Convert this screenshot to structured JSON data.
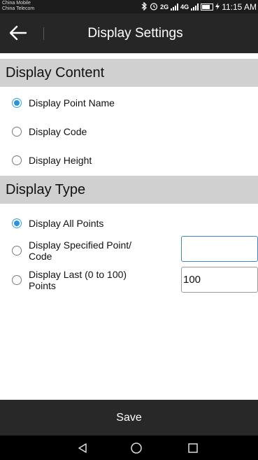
{
  "status_bar": {
    "carrier_1": "China Mobile",
    "carrier_2": "China Telecom",
    "network_1": "2G",
    "network_2": "4G",
    "battery_level": "88",
    "time": "11:15 AM"
  },
  "header": {
    "title": "Display Settings"
  },
  "display_content": {
    "heading": "Display Content",
    "options": [
      {
        "label": "Display Point Name",
        "selected": true
      },
      {
        "label": "Display Code",
        "selected": false
      },
      {
        "label": "Display Height",
        "selected": false
      }
    ]
  },
  "display_type": {
    "heading": "Display Type",
    "options": [
      {
        "label": "Display All Points",
        "selected": true
      },
      {
        "label": "Display Specified Point/\nCode",
        "selected": false,
        "input_value": ""
      },
      {
        "label": "Display Last (0 to 100)\nPoints",
        "selected": false,
        "input_value": "100"
      }
    ]
  },
  "footer": {
    "save_label": "Save"
  },
  "colors": {
    "accent": "#2a93dc",
    "section_bg": "#d0d0d0",
    "titlebar_bg": "#262626"
  }
}
